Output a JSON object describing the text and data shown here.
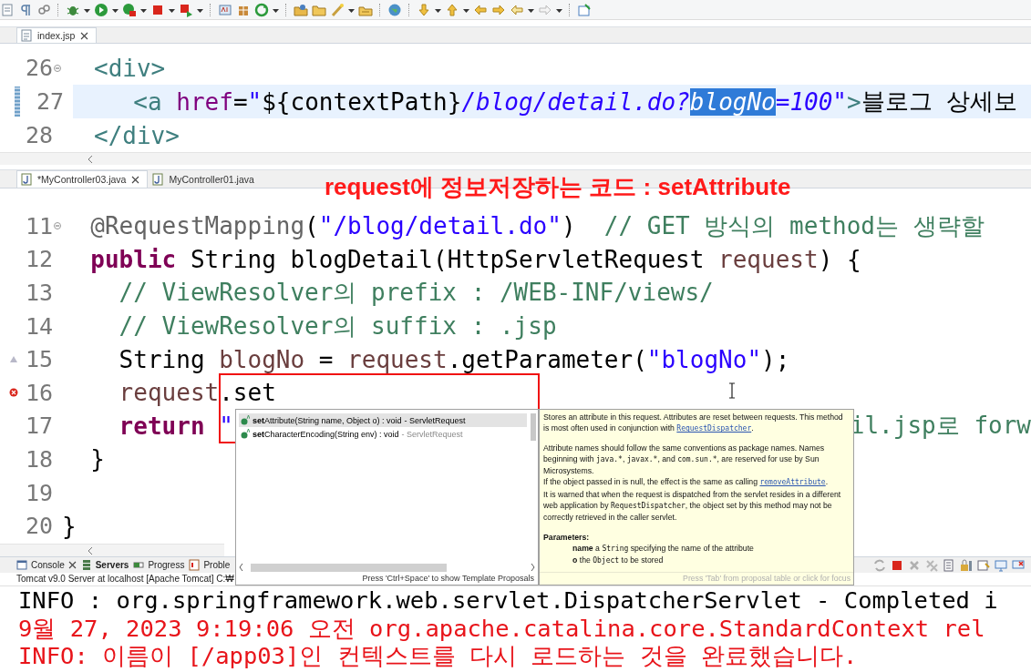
{
  "editors": [
    {
      "tabs": [
        {
          "label": "index.jsp",
          "selected": true,
          "closable": true
        }
      ],
      "lines": [
        {
          "number": "26",
          "current": false,
          "foldable": true,
          "tokens": [
            {
              "text": "<div>",
              "kind": "tag"
            }
          ]
        },
        {
          "number": "27",
          "current": true,
          "foldable": false,
          "tokens": [
            {
              "text": "  <a",
              "kind": "tag"
            },
            {
              "text": " href",
              "kind": "attr"
            },
            {
              "text": "=",
              "kind": "plain"
            },
            {
              "text": "\"",
              "kind": "jsp-string"
            },
            {
              "text": "${contextPath}",
              "kind": "plain"
            },
            {
              "text": "/blog/detail.do?",
              "kind": "jsp-string"
            },
            {
              "text": "blogNo",
              "kind": "selection"
            },
            {
              "text": "=100\"",
              "kind": "jsp-string"
            },
            {
              "text": ">",
              "kind": "tag"
            },
            {
              "text": "블로그 상세보",
              "kind": "plain"
            }
          ]
        },
        {
          "number": "28",
          "current": false,
          "foldable": false,
          "tokens": [
            {
              "text": "</div>",
              "kind": "tag"
            }
          ]
        }
      ]
    },
    {
      "tabs": [
        {
          "label": "*MyController03.java",
          "selected": true,
          "closable": true
        },
        {
          "label": "MyController01.java",
          "selected": false,
          "closable": false
        }
      ],
      "lines": [
        {
          "number": "11",
          "current": false,
          "foldable": true,
          "error": false,
          "override": false,
          "tokens": [
            {
              "text": "  @RequestMapping",
              "kind": "annotation"
            },
            {
              "text": "(",
              "kind": "plain"
            },
            {
              "text": "\"/blog/detail.do\"",
              "kind": "string"
            },
            {
              "text": ")  ",
              "kind": "plain"
            },
            {
              "text": "// GET 방식의 method는 생략할",
              "kind": "comment"
            }
          ]
        },
        {
          "number": "12",
          "current": false,
          "foldable": false,
          "error": false,
          "override": false,
          "tokens": [
            {
              "text": "  public",
              "kind": "keyword"
            },
            {
              "text": " String blogDetail(HttpServletRequest ",
              "kind": "plain"
            },
            {
              "text": "request",
              "kind": "param"
            },
            {
              "text": ") {",
              "kind": "plain"
            }
          ]
        },
        {
          "number": "13",
          "current": false,
          "foldable": false,
          "error": false,
          "override": false,
          "tokens": [
            {
              "text": "    // ViewResolver의 prefix : /WEB-INF/views/",
              "kind": "comment"
            }
          ]
        },
        {
          "number": "14",
          "current": false,
          "foldable": false,
          "error": false,
          "override": false,
          "tokens": [
            {
              "text": "    // ViewResolver의 suffix : .jsp",
              "kind": "comment"
            }
          ]
        },
        {
          "number": "15",
          "current": false,
          "foldable": false,
          "error": false,
          "override": true,
          "tokens": [
            {
              "text": "    String ",
              "kind": "plain"
            },
            {
              "text": "blogNo",
              "kind": "param"
            },
            {
              "text": " = ",
              "kind": "plain"
            },
            {
              "text": "request",
              "kind": "param"
            },
            {
              "text": ".getParameter(",
              "kind": "plain"
            },
            {
              "text": "\"blogNo\"",
              "kind": "string"
            },
            {
              "text": ");",
              "kind": "plain"
            }
          ]
        },
        {
          "number": "16",
          "current": false,
          "foldable": false,
          "error": true,
          "override": false,
          "tokens": [
            {
              "text": "    request",
              "kind": "param"
            },
            {
              "text": ".set",
              "kind": "plain"
            }
          ]
        },
        {
          "number": "17",
          "current": false,
          "foldable": false,
          "error": false,
          "override": false,
          "tokens": [
            {
              "text": "    return",
              "kind": "keyword"
            },
            {
              "text": " \"",
              "kind": "string"
            }
          ],
          "tail": [
            {
              "text": "il.jsp로 forw",
              "kind": "comment"
            }
          ]
        },
        {
          "number": "18",
          "current": false,
          "foldable": false,
          "error": false,
          "override": false,
          "tokens": [
            {
              "text": "  }",
              "kind": "plain"
            }
          ]
        },
        {
          "number": "19",
          "current": false,
          "foldable": false,
          "error": false,
          "override": false
        },
        {
          "number": "20",
          "current": false,
          "foldable": false,
          "error": false,
          "override": false,
          "tokens": [
            {
              "text": "}",
              "kind": "plain"
            }
          ]
        }
      ]
    }
  ],
  "annotation": {
    "text": "request에 정보저장하는 코드 : setAttribute"
  },
  "completion": {
    "proposals": [
      {
        "label": "**set**Attribute(String name, Object o) : void",
        "qualifier": "- ServletRequest",
        "selected": true
      },
      {
        "label": "**set**CharacterEncoding(String env) : void",
        "qualifier": "- ServletRequest",
        "selected": false
      }
    ],
    "hint": "Press 'Ctrl+Space' to show Template Proposals"
  },
  "javadoc": {
    "blocks": [
      {
        "kind": "line",
        "segments": [
          {
            "kind": "text",
            "text": "Stores an attribute in this request. Attributes are reset between requests. This method is most often used in conjunction with "
          },
          {
            "kind": "link",
            "text": "RequestDispatcher"
          },
          {
            "kind": "text",
            "text": "."
          }
        ]
      },
      {
        "kind": "para",
        "segments": [
          {
            "kind": "text",
            "text": "Attribute names should follow the same conventions as package names. Names beginning with "
          },
          {
            "kind": "code",
            "text": "java.*"
          },
          {
            "kind": "text",
            "text": ", "
          },
          {
            "kind": "code",
            "text": "javax.*"
          },
          {
            "kind": "text",
            "text": ", and "
          },
          {
            "kind": "code",
            "text": "com.sun.*"
          },
          {
            "kind": "text",
            "text": ", are reserved for use by Sun Microsystems."
          }
        ]
      },
      {
        "kind": "line",
        "segments": [
          {
            "kind": "text",
            "text": "If the object passed in is null, the effect is the same as calling "
          },
          {
            "kind": "link",
            "text": "removeAttribute"
          },
          {
            "kind": "text",
            "text": "."
          }
        ]
      },
      {
        "kind": "line",
        "segments": [
          {
            "kind": "text",
            "text": "It is warned that when the request is dispatched from the servlet resides in a different web application by "
          },
          {
            "kind": "code",
            "text": "RequestDispatcher"
          },
          {
            "kind": "text",
            "text": ", the object set by this method may not be correctly retrieved in the caller servlet."
          }
        ]
      },
      {
        "kind": "heading",
        "segments": [
          {
            "kind": "text",
            "text": "Parameters:"
          }
        ]
      },
      {
        "kind": "param",
        "segments": [
          {
            "kind": "bold",
            "text": "name"
          },
          {
            "kind": "text",
            "text": " a "
          },
          {
            "kind": "code",
            "text": "String"
          },
          {
            "kind": "text",
            "text": " specifying the name of the attribute"
          }
        ]
      },
      {
        "kind": "param",
        "segments": [
          {
            "kind": "bold",
            "text": "o"
          },
          {
            "kind": "text",
            "text": " the "
          },
          {
            "kind": "code",
            "text": "Object"
          },
          {
            "kind": "text",
            "text": " to be stored"
          }
        ]
      }
    ],
    "footer": "Press 'Tab' from proposal table or click for focus"
  },
  "console": {
    "tabs": [
      {
        "label": "Console",
        "selected": false,
        "closable": true
      },
      {
        "label": "Servers",
        "selected": true,
        "closable": false
      },
      {
        "label": "Progress",
        "selected": false,
        "closable": false
      },
      {
        "label": "Proble",
        "selected": false,
        "closable": false
      }
    ],
    "status": "Tomcat v9.0 Server at localhost [Apache Tomcat] C:₩",
    "lines": [
      {
        "text": "INFO : org.springframework.web.servlet.DispatcherServlet - Completed i",
        "kind": "info"
      },
      {
        "text": "9월 27, 2023 9:19:06 오전 org.apache.catalina.core.StandardContext rel",
        "kind": "error"
      },
      {
        "text": "INFO: 이름이 [/app03]인 컨텍스트를 다시 로드하는 것을 완료했습니다.",
        "kind": "error"
      }
    ]
  }
}
